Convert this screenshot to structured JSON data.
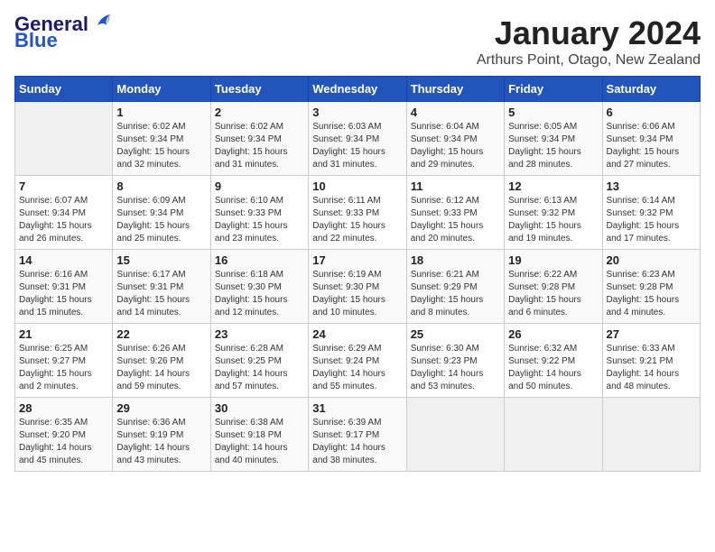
{
  "header": {
    "logo_general": "General",
    "logo_blue": "Blue",
    "month": "January 2024",
    "location": "Arthurs Point, Otago, New Zealand"
  },
  "weekdays": [
    "Sunday",
    "Monday",
    "Tuesday",
    "Wednesday",
    "Thursday",
    "Friday",
    "Saturday"
  ],
  "weeks": [
    [
      {
        "day": "",
        "info": ""
      },
      {
        "day": "1",
        "info": "Sunrise: 6:02 AM\nSunset: 9:34 PM\nDaylight: 15 hours\nand 32 minutes."
      },
      {
        "day": "2",
        "info": "Sunrise: 6:02 AM\nSunset: 9:34 PM\nDaylight: 15 hours\nand 31 minutes."
      },
      {
        "day": "3",
        "info": "Sunrise: 6:03 AM\nSunset: 9:34 PM\nDaylight: 15 hours\nand 31 minutes."
      },
      {
        "day": "4",
        "info": "Sunrise: 6:04 AM\nSunset: 9:34 PM\nDaylight: 15 hours\nand 29 minutes."
      },
      {
        "day": "5",
        "info": "Sunrise: 6:05 AM\nSunset: 9:34 PM\nDaylight: 15 hours\nand 28 minutes."
      },
      {
        "day": "6",
        "info": "Sunrise: 6:06 AM\nSunset: 9:34 PM\nDaylight: 15 hours\nand 27 minutes."
      }
    ],
    [
      {
        "day": "7",
        "info": "Sunrise: 6:07 AM\nSunset: 9:34 PM\nDaylight: 15 hours\nand 26 minutes."
      },
      {
        "day": "8",
        "info": "Sunrise: 6:09 AM\nSunset: 9:34 PM\nDaylight: 15 hours\nand 25 minutes."
      },
      {
        "day": "9",
        "info": "Sunrise: 6:10 AM\nSunset: 9:33 PM\nDaylight: 15 hours\nand 23 minutes."
      },
      {
        "day": "10",
        "info": "Sunrise: 6:11 AM\nSunset: 9:33 PM\nDaylight: 15 hours\nand 22 minutes."
      },
      {
        "day": "11",
        "info": "Sunrise: 6:12 AM\nSunset: 9:33 PM\nDaylight: 15 hours\nand 20 minutes."
      },
      {
        "day": "12",
        "info": "Sunrise: 6:13 AM\nSunset: 9:32 PM\nDaylight: 15 hours\nand 19 minutes."
      },
      {
        "day": "13",
        "info": "Sunrise: 6:14 AM\nSunset: 9:32 PM\nDaylight: 15 hours\nand 17 minutes."
      }
    ],
    [
      {
        "day": "14",
        "info": "Sunrise: 6:16 AM\nSunset: 9:31 PM\nDaylight: 15 hours\nand 15 minutes."
      },
      {
        "day": "15",
        "info": "Sunrise: 6:17 AM\nSunset: 9:31 PM\nDaylight: 15 hours\nand 14 minutes."
      },
      {
        "day": "16",
        "info": "Sunrise: 6:18 AM\nSunset: 9:30 PM\nDaylight: 15 hours\nand 12 minutes."
      },
      {
        "day": "17",
        "info": "Sunrise: 6:19 AM\nSunset: 9:30 PM\nDaylight: 15 hours\nand 10 minutes."
      },
      {
        "day": "18",
        "info": "Sunrise: 6:21 AM\nSunset: 9:29 PM\nDaylight: 15 hours\nand 8 minutes."
      },
      {
        "day": "19",
        "info": "Sunrise: 6:22 AM\nSunset: 9:28 PM\nDaylight: 15 hours\nand 6 minutes."
      },
      {
        "day": "20",
        "info": "Sunrise: 6:23 AM\nSunset: 9:28 PM\nDaylight: 15 hours\nand 4 minutes."
      }
    ],
    [
      {
        "day": "21",
        "info": "Sunrise: 6:25 AM\nSunset: 9:27 PM\nDaylight: 15 hours\nand 2 minutes."
      },
      {
        "day": "22",
        "info": "Sunrise: 6:26 AM\nSunset: 9:26 PM\nDaylight: 14 hours\nand 59 minutes."
      },
      {
        "day": "23",
        "info": "Sunrise: 6:28 AM\nSunset: 9:25 PM\nDaylight: 14 hours\nand 57 minutes."
      },
      {
        "day": "24",
        "info": "Sunrise: 6:29 AM\nSunset: 9:24 PM\nDaylight: 14 hours\nand 55 minutes."
      },
      {
        "day": "25",
        "info": "Sunrise: 6:30 AM\nSunset: 9:23 PM\nDaylight: 14 hours\nand 53 minutes."
      },
      {
        "day": "26",
        "info": "Sunrise: 6:32 AM\nSunset: 9:22 PM\nDaylight: 14 hours\nand 50 minutes."
      },
      {
        "day": "27",
        "info": "Sunrise: 6:33 AM\nSunset: 9:21 PM\nDaylight: 14 hours\nand 48 minutes."
      }
    ],
    [
      {
        "day": "28",
        "info": "Sunrise: 6:35 AM\nSunset: 9:20 PM\nDaylight: 14 hours\nand 45 minutes."
      },
      {
        "day": "29",
        "info": "Sunrise: 6:36 AM\nSunset: 9:19 PM\nDaylight: 14 hours\nand 43 minutes."
      },
      {
        "day": "30",
        "info": "Sunrise: 6:38 AM\nSunset: 9:18 PM\nDaylight: 14 hours\nand 40 minutes."
      },
      {
        "day": "31",
        "info": "Sunrise: 6:39 AM\nSunset: 9:17 PM\nDaylight: 14 hours\nand 38 minutes."
      },
      {
        "day": "",
        "info": ""
      },
      {
        "day": "",
        "info": ""
      },
      {
        "day": "",
        "info": ""
      }
    ]
  ]
}
